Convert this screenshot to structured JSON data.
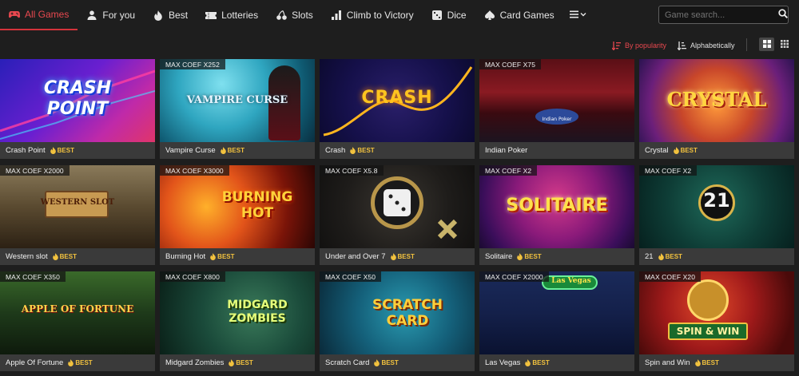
{
  "nav": {
    "tabs": [
      {
        "label": "All Games",
        "icon": "gamepad-icon",
        "active": true
      },
      {
        "label": "For you",
        "icon": "user-icon",
        "active": false
      },
      {
        "label": "Best",
        "icon": "flame-icon",
        "active": false
      },
      {
        "label": "Lotteries",
        "icon": "ticket-icon",
        "active": false
      },
      {
        "label": "Slots",
        "icon": "cherries-icon",
        "active": false
      },
      {
        "label": "Climb to Victory",
        "icon": "bar-chart-icon",
        "active": false
      },
      {
        "label": "Dice",
        "icon": "dice-icon",
        "active": false
      },
      {
        "label": "Card Games",
        "icon": "spade-icon",
        "active": false
      }
    ],
    "more_icon": "menu-chevron-icon",
    "search_placeholder": "Game search..."
  },
  "sort": {
    "popularity_label": "By popularity",
    "alphabetical_label": "Alphabetically",
    "active": "popularity",
    "view_mode": "large-grid"
  },
  "colors": {
    "accent": "#e8484f",
    "badge": "#f2c23e",
    "background": "#1e1e1e",
    "card": "#3a3a3a"
  },
  "badge_label": "BEST",
  "games": [
    {
      "name": "Crash Point",
      "coef": "",
      "art": "CRASH POINT"
    },
    {
      "name": "Vampire Curse",
      "coef": "MAX COEF X252",
      "art": "VAMPIRE CURSE"
    },
    {
      "name": "Crash",
      "coef": "",
      "art": "CRASH"
    },
    {
      "name": "Indian Poker",
      "coef": "MAX COEF X75",
      "art": "Indian Poker"
    },
    {
      "name": "Crystal",
      "coef": "",
      "art": "CRYSTAL"
    },
    {
      "name": "Western slot",
      "coef": "MAX COEF X2000",
      "art": "WESTERN SLOT"
    },
    {
      "name": "Burning Hot",
      "coef": "MAX COEF X3000",
      "art": "BURNING HOT"
    },
    {
      "name": "Under and Over 7",
      "coef": "MAX COEF X5.8",
      "art": ""
    },
    {
      "name": "Solitaire",
      "coef": "MAX COEF X2",
      "art": "SOLITAIRE"
    },
    {
      "name": "21",
      "coef": "MAX COEF X2",
      "art": "21"
    },
    {
      "name": "Apple Of Fortune",
      "coef": "MAX COEF X350",
      "art": "APPLE OF FORTUNE"
    },
    {
      "name": "Midgard Zombies",
      "coef": "MAX COEF X800",
      "art": "MIDGARD ZOMBIES"
    },
    {
      "name": "Scratch Card",
      "coef": "MAX COEF X50",
      "art": "SCRATCH CARD"
    },
    {
      "name": "Las Vegas",
      "coef": "MAX COEF X2000",
      "art": "Las Vegas"
    },
    {
      "name": "Spin and Win",
      "coef": "MAX COEF X20",
      "art": "SPIN & WIN"
    }
  ]
}
